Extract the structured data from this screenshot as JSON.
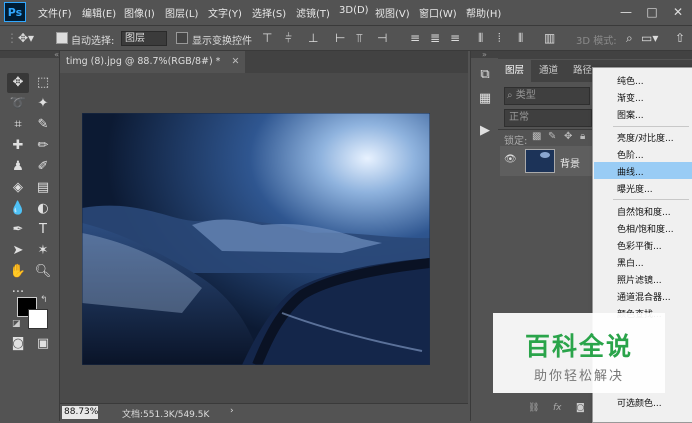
{
  "app": {
    "logo": "Ps"
  },
  "menubar": {
    "items": [
      "文件(F)",
      "编辑(E)",
      "图像(I)",
      "图层(L)",
      "文字(Y)",
      "选择(S)",
      "滤镜(T)",
      "3D(D)",
      "视图(V)",
      "窗口(W)",
      "帮助(H)"
    ]
  },
  "options": {
    "auto_select_label": "自动选择:",
    "auto_select_value": "图层",
    "show_transform_label": "显示变换控件",
    "mode_3d_label": "3D 模式:"
  },
  "document": {
    "tab_title": "timg (8).jpg @ 88.7%(RGB/8#) *",
    "zoom": "88.73%",
    "doc_info": "文档:551.3K/549.5K"
  },
  "layers_panel": {
    "tabs": [
      "图层",
      "通道",
      "路径"
    ],
    "filter_kind": "类型",
    "blend_mode": "正常",
    "lock_label": "锁定:",
    "layer_name": "背景"
  },
  "adjustment_menu": {
    "items": [
      {
        "label": "纯色..."
      },
      {
        "label": "渐变..."
      },
      {
        "label": "图案..."
      },
      {
        "label": "亮度/对比度..."
      },
      {
        "label": "色阶..."
      },
      {
        "label": "曲线...",
        "highlighted": true
      },
      {
        "label": "曝光度..."
      },
      {
        "label": "自然饱和度..."
      },
      {
        "label": "色相/饱和度..."
      },
      {
        "label": "色彩平衡..."
      },
      {
        "label": "黑白..."
      },
      {
        "label": "照片滤镜..."
      },
      {
        "label": "通道混合器..."
      },
      {
        "label": "颜色查找..."
      },
      {
        "label": "可选颜色..."
      }
    ]
  },
  "watermark": {
    "title": "百科全说",
    "subtitle": "助你轻松解决"
  },
  "colors": {
    "chrome": "#535353",
    "canvas_bg": "#2b2b2b",
    "menu_highlight": "#99ccf5",
    "watermark_green": "#2aa44a",
    "photo_blue": "#1c3358"
  }
}
